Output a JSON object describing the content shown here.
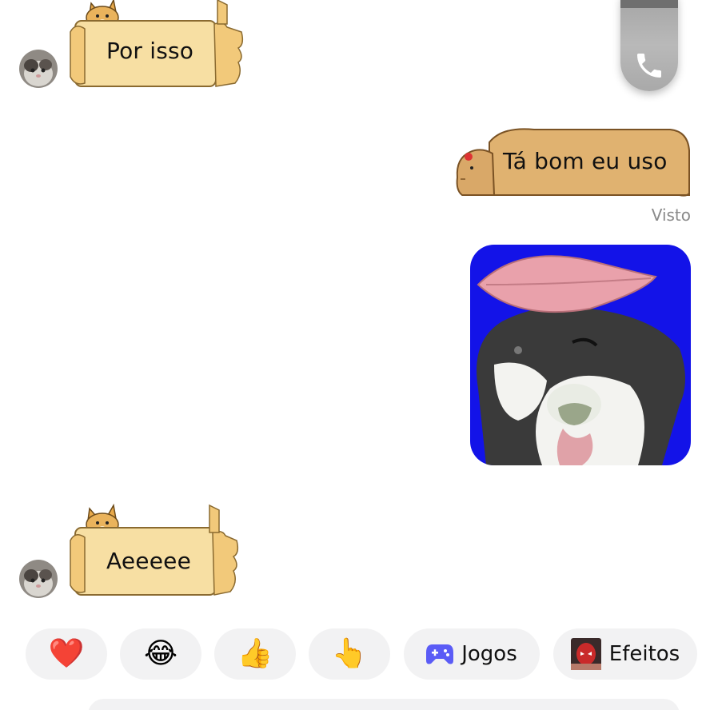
{
  "messages": {
    "incoming_1": {
      "text": "Por isso",
      "sticker": "doge-sign"
    },
    "outgoing_1": {
      "text": "Tá bom eu uso",
      "sticker": "capybara-sign",
      "status": "Visto"
    },
    "outgoing_image": {
      "description_icon": "dog-with-leaf-sticker",
      "background": "#1313e8"
    },
    "incoming_2": {
      "text": "Aeeeee",
      "sticker": "doge-sign"
    }
  },
  "call_widget": {
    "icon": "phone-icon"
  },
  "quick_actions": [
    {
      "icon": "heart-emoji",
      "emoji": "❤️"
    },
    {
      "icon": "laughing-emoji",
      "emoji": "😂"
    },
    {
      "icon": "thumbs-up-emoji",
      "emoji": "👍"
    },
    {
      "icon": "pointing-hand-emoji",
      "emoji": "👆"
    },
    {
      "icon": "gamepad-icon",
      "label": "Jogos"
    },
    {
      "icon": "effects-avatar",
      "label": "Efeitos"
    }
  ],
  "colors": {
    "doge_sign": "#f7dfa3",
    "capybara_sign": "#e0b270",
    "chip_bg": "#f2f2f3",
    "seen_text": "#8a8a8a",
    "games_icon": "#5b5cf6"
  }
}
